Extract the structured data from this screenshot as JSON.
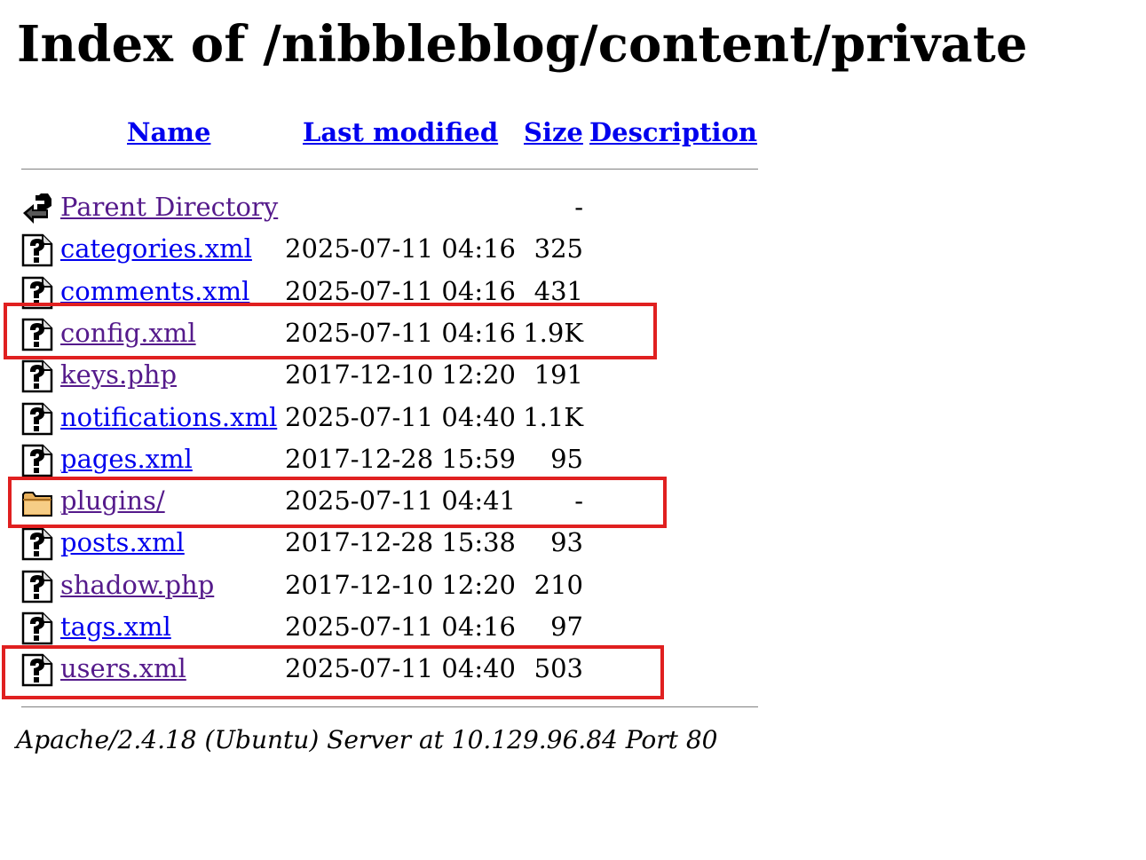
{
  "title": "Index of /nibbleblog/content/private",
  "columns": {
    "name": "Name",
    "last_modified": "Last modified",
    "size": "Size",
    "description": "Description"
  },
  "entries": [
    {
      "name": "Parent Directory",
      "modified": "",
      "size": "-",
      "icon": "back-icon",
      "visited": true
    },
    {
      "name": "categories.xml",
      "modified": "2025-07-11 04:16",
      "size": "325",
      "icon": "unknown-file-icon",
      "visited": false
    },
    {
      "name": "comments.xml",
      "modified": "2025-07-11 04:16",
      "size": "431",
      "icon": "unknown-file-icon",
      "visited": false
    },
    {
      "name": "config.xml",
      "modified": "2025-07-11 04:16",
      "size": "1.9K",
      "icon": "unknown-file-icon",
      "visited": true
    },
    {
      "name": "keys.php",
      "modified": "2017-12-10 12:20",
      "size": "191",
      "icon": "unknown-file-icon",
      "visited": true
    },
    {
      "name": "notifications.xml",
      "modified": "2025-07-11 04:40",
      "size": "1.1K",
      "icon": "unknown-file-icon",
      "visited": false
    },
    {
      "name": "pages.xml",
      "modified": "2017-12-28 15:59",
      "size": "95",
      "icon": "unknown-file-icon",
      "visited": false
    },
    {
      "name": "plugins/",
      "modified": "2025-07-11 04:41",
      "size": "-",
      "icon": "folder-icon",
      "visited": true
    },
    {
      "name": "posts.xml",
      "modified": "2017-12-28 15:38",
      "size": "93",
      "icon": "unknown-file-icon",
      "visited": false
    },
    {
      "name": "shadow.php",
      "modified": "2017-12-10 12:20",
      "size": "210",
      "icon": "unknown-file-icon",
      "visited": true
    },
    {
      "name": "tags.xml",
      "modified": "2025-07-11 04:16",
      "size": "97",
      "icon": "unknown-file-icon",
      "visited": false
    },
    {
      "name": "users.xml",
      "modified": "2025-07-11 04:40",
      "size": "503",
      "icon": "unknown-file-icon",
      "visited": true
    }
  ],
  "highlighted_entries": [
    "config.xml",
    "plugins/",
    "users.xml"
  ],
  "highlight_color": "#e02020",
  "link_color": "#0000ee",
  "visited_link_color": "#551a8b",
  "footer": "Apache/2.4.18 (Ubuntu) Server at 10.129.96.84 Port 80"
}
